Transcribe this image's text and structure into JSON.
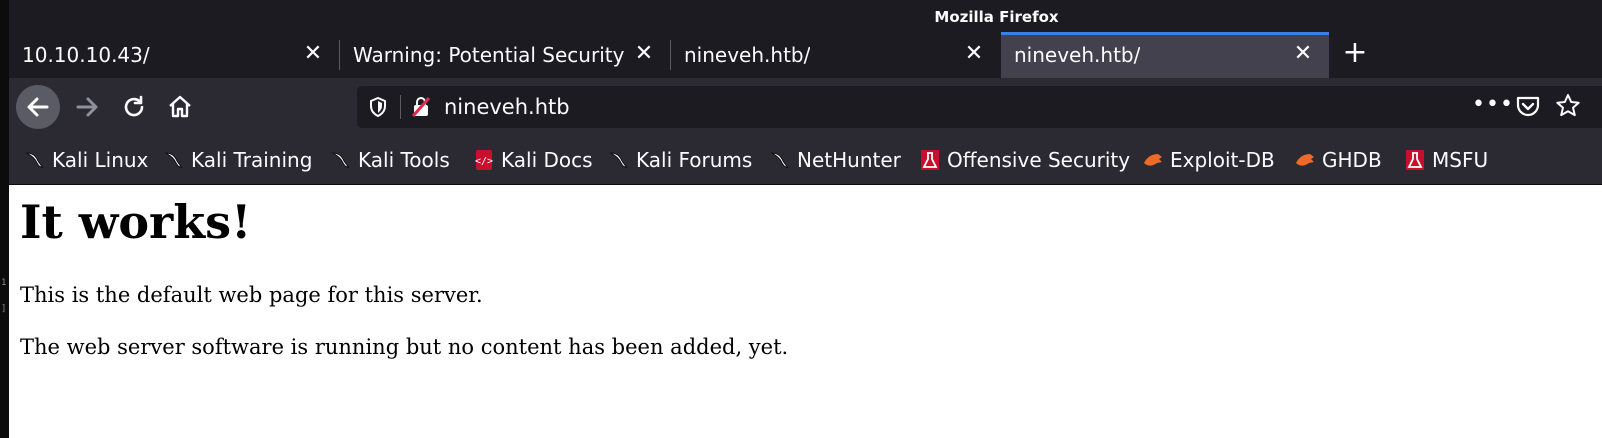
{
  "window": {
    "title": "Mozilla Firefox"
  },
  "tabs": [
    {
      "label": "10.10.10.43/",
      "active": false
    },
    {
      "label": "Warning: Potential Security Risk Ahead",
      "active": false
    },
    {
      "label": "nineveh.htb/",
      "active": false
    },
    {
      "label": "nineveh.htb/",
      "active": true
    }
  ],
  "close_glyph": "✕",
  "new_tab_glyph": "+",
  "urlbar": {
    "url": "nineveh.htb"
  },
  "bookmarks": [
    {
      "label": "Kali Linux",
      "icon": "kali-dragon-icon"
    },
    {
      "label": "Kali Training",
      "icon": "kali-dragon-icon"
    },
    {
      "label": "Kali Tools",
      "icon": "kali-dragon-icon"
    },
    {
      "label": "Kali Docs",
      "icon": "kali-docs-icon"
    },
    {
      "label": "Kali Forums",
      "icon": "kali-dragon-icon"
    },
    {
      "label": "NetHunter",
      "icon": "kali-dragon-icon"
    },
    {
      "label": "Offensive Security",
      "icon": "offsec-icon"
    },
    {
      "label": "Exploit-DB",
      "icon": "exploit-db-icon"
    },
    {
      "label": "GHDB",
      "icon": "ghdb-icon"
    },
    {
      "label": "MSFU",
      "icon": "offsec-icon"
    }
  ],
  "page": {
    "heading": "It works!",
    "paragraph1": "This is the default web page for this server.",
    "paragraph2": "The web server software is running but no content has been added, yet."
  },
  "colors": {
    "accent": "#3b7ee8",
    "toolbar": "#2b2a33",
    "tabstrip": "#1c1b22",
    "active_tab": "#42414d"
  }
}
